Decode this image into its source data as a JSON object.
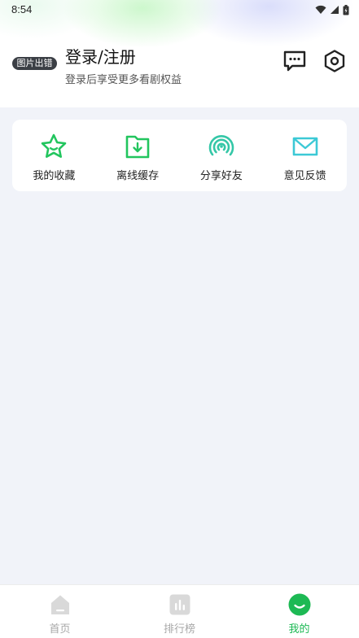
{
  "status_bar": {
    "time": "8:54"
  },
  "profile": {
    "avatar_alt": "图片出错",
    "login_title": "登录/注册",
    "login_subtitle": "登录后享受更多看剧权益"
  },
  "header_icons": [
    "message-icon",
    "settings-icon"
  ],
  "quick_actions": [
    {
      "label": "我的收藏",
      "icon": "star-icon",
      "color": "#22c55e"
    },
    {
      "label": "离线缓存",
      "icon": "folder-download-icon",
      "color": "#22c55e"
    },
    {
      "label": "分享好友",
      "icon": "broadcast-icon",
      "color": "#34c7a7"
    },
    {
      "label": "意见反馈",
      "icon": "mail-icon",
      "color": "#3cc9d6"
    }
  ],
  "tabbar": [
    {
      "label": "首页",
      "icon": "home-icon",
      "active": false
    },
    {
      "label": "排行榜",
      "icon": "chart-icon",
      "active": false
    },
    {
      "label": "我的",
      "icon": "smile-icon",
      "active": true
    }
  ],
  "colors": {
    "accent": "#1db954",
    "background": "#f1f3f9",
    "inactive": "#a8a8a8"
  }
}
